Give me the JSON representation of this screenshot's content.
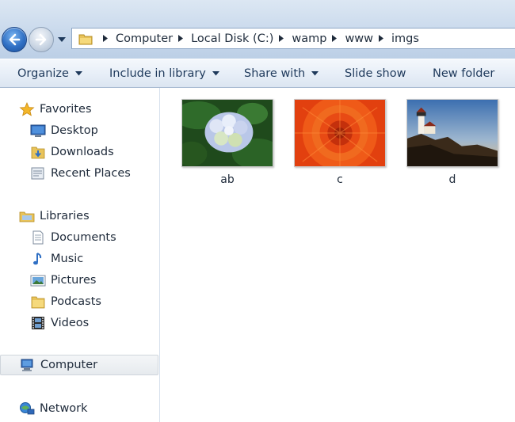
{
  "address": {
    "breadcrumbs": [
      "Computer",
      "Local Disk (C:)",
      "wamp",
      "www",
      "imgs"
    ]
  },
  "toolbar": {
    "organize": "Organize",
    "include_in_library": "Include in library",
    "share_with": "Share with",
    "slide_show": "Slide show",
    "new_folder": "New folder"
  },
  "nav": {
    "favorites": "Favorites",
    "desktop": "Desktop",
    "downloads": "Downloads",
    "recent_places": "Recent Places",
    "libraries": "Libraries",
    "documents": "Documents",
    "music": "Music",
    "pictures": "Pictures",
    "podcasts": "Podcasts",
    "videos": "Videos",
    "computer": "Computer",
    "network": "Network"
  },
  "files": [
    {
      "name": "ab",
      "icon": "hydrangea-thumbnail"
    },
    {
      "name": "c",
      "icon": "orange-flower-thumbnail"
    },
    {
      "name": "d",
      "icon": "lighthouse-thumbnail"
    }
  ],
  "colors": {
    "accent": "#2f6fc4",
    "folder": "#e8c35a"
  }
}
